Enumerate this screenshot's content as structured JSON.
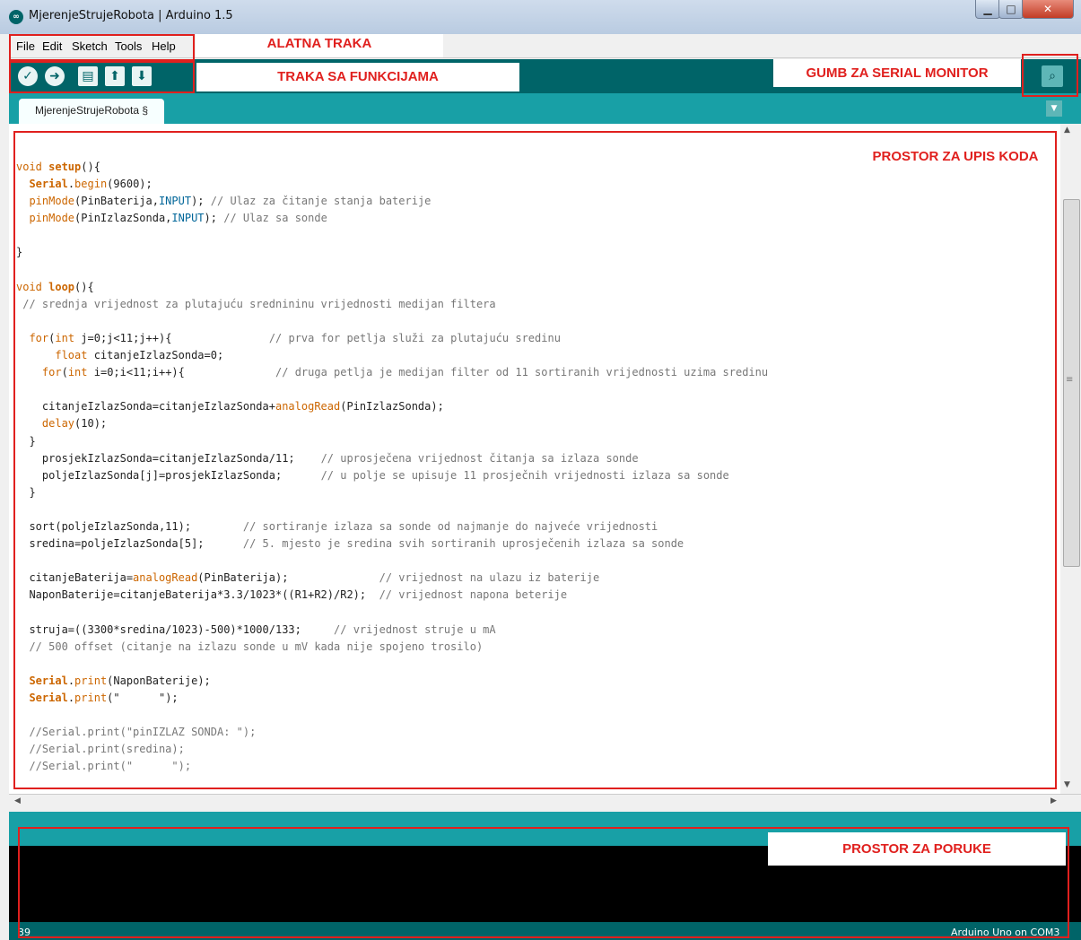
{
  "window": {
    "title": "MjerenjeStrujeRobota | Arduino 1.5",
    "app_icon": "arduino-infinity-icon",
    "controls": {
      "minimize": "minimize-icon",
      "maximize": "maximize-icon",
      "close": "close-icon"
    }
  },
  "menu": [
    "File",
    "Edit",
    "Sketch",
    "Tools",
    "Help"
  ],
  "toolbar": {
    "buttons": [
      {
        "name": "verify",
        "icon": "checkmark-icon"
      },
      {
        "name": "upload",
        "icon": "arrow-right-icon"
      },
      {
        "name": "new",
        "icon": "new-file-icon"
      },
      {
        "name": "open",
        "icon": "upload-arrow-icon"
      },
      {
        "name": "save",
        "icon": "download-arrow-icon"
      }
    ],
    "serial_monitor_icon": "magnifier-icon"
  },
  "tab": {
    "label": "MjerenjeStrujeRobota §"
  },
  "status": {
    "line": "39",
    "board": "Arduino Uno on COM3"
  },
  "annotations": {
    "menubar": "ALATNA TRAKA",
    "toolbar": "TRAKA SA FUNKCIJAMA",
    "serial": "GUMB ZA SERIAL MONITOR",
    "editor": "PROSTOR ZA UPIS KODA",
    "messages": "PROSTOR ZA PORUKE"
  },
  "colors": {
    "teal_dark": "#006468",
    "teal_light": "#18a0a6",
    "annotation_red": "#e0201e"
  },
  "code": [
    [
      {
        "t": "void ",
        "c": "kw"
      },
      {
        "t": "setup",
        "c": "bold"
      },
      {
        "t": "(){"
      }
    ],
    [
      {
        "t": "  "
      },
      {
        "t": "Serial",
        "c": "bold"
      },
      {
        "t": "."
      },
      {
        "t": "begin",
        "c": "kw"
      },
      {
        "t": "(9600);"
      }
    ],
    [
      {
        "t": "  "
      },
      {
        "t": "pinMode",
        "c": "kw"
      },
      {
        "t": "(PinBaterija,"
      },
      {
        "t": "INPUT",
        "c": "const"
      },
      {
        "t": "); "
      },
      {
        "t": "// Ulaz za čitanje stanja baterije",
        "c": "cm"
      }
    ],
    [
      {
        "t": "  "
      },
      {
        "t": "pinMode",
        "c": "kw"
      },
      {
        "t": "(PinIzlazSonda,"
      },
      {
        "t": "INPUT",
        "c": "const"
      },
      {
        "t": "); "
      },
      {
        "t": "// Ulaz sa sonde",
        "c": "cm"
      }
    ],
    [],
    [
      {
        "t": "}"
      }
    ],
    [],
    [
      {
        "t": "void ",
        "c": "kw"
      },
      {
        "t": "loop",
        "c": "bold"
      },
      {
        "t": "(){"
      }
    ],
    [
      {
        "t": " // srednja vrijednost za plutajuću srednininu vrijednosti medijan filtera",
        "c": "cm"
      }
    ],
    [],
    [
      {
        "t": "  "
      },
      {
        "t": "for",
        "c": "kw"
      },
      {
        "t": "("
      },
      {
        "t": "int",
        "c": "kw"
      },
      {
        "t": " j=0;j<11;j++){               "
      },
      {
        "t": "// prva for petlja služi za plutajuću sredinu",
        "c": "cm"
      }
    ],
    [
      {
        "t": "      "
      },
      {
        "t": "float",
        "c": "kw"
      },
      {
        "t": " citanjeIzlazSonda=0;"
      }
    ],
    [
      {
        "t": "    "
      },
      {
        "t": "for",
        "c": "kw"
      },
      {
        "t": "("
      },
      {
        "t": "int",
        "c": "kw"
      },
      {
        "t": " i=0;i<11;i++){              "
      },
      {
        "t": "// druga petlja je medijan filter od 11 sortiranih vrijednosti uzima sredinu",
        "c": "cm"
      }
    ],
    [],
    [
      {
        "t": "    citanjeIzlazSonda=citanjeIzlazSonda+"
      },
      {
        "t": "analogRead",
        "c": "kw"
      },
      {
        "t": "(PinIzlazSonda);"
      }
    ],
    [
      {
        "t": "    "
      },
      {
        "t": "delay",
        "c": "kw"
      },
      {
        "t": "(10);"
      }
    ],
    [
      {
        "t": "  }"
      }
    ],
    [
      {
        "t": "    prosjekIzlazSonda=citanjeIzlazSonda/11;    "
      },
      {
        "t": "// uprosječena vrijednost čitanja sa izlaza sonde",
        "c": "cm"
      }
    ],
    [
      {
        "t": "    poljeIzlazSonda[j]=prosjekIzlazSonda;      "
      },
      {
        "t": "// u polje se upisuje 11 prosječnih vrijednosti izlaza sa sonde",
        "c": "cm"
      }
    ],
    [
      {
        "t": "  }"
      }
    ],
    [],
    [
      {
        "t": "  sort(poljeIzlazSonda,11);        "
      },
      {
        "t": "// sortiranje izlaza sa sonde od najmanje do najveće vrijednosti",
        "c": "cm"
      }
    ],
    [
      {
        "t": "  sredina=poljeIzlazSonda[5];      "
      },
      {
        "t": "// 5. mjesto je sredina svih sortiranih uprosječenih izlaza sa sonde",
        "c": "cm"
      }
    ],
    [],
    [
      {
        "t": "  citanjeBaterija="
      },
      {
        "t": "analogRead",
        "c": "kw"
      },
      {
        "t": "(PinBaterija);              "
      },
      {
        "t": "// vrijednost na ulazu iz baterije",
        "c": "cm"
      }
    ],
    [
      {
        "t": "  NaponBaterije=citanjeBaterija*3.3/1023*((R1+R2)/R2);  "
      },
      {
        "t": "// vrijednost napona beterije",
        "c": "cm"
      }
    ],
    [],
    [
      {
        "t": "  struja=((3300*sredina/1023)-500)*1000/133;     "
      },
      {
        "t": "// vrijednost struje u mA",
        "c": "cm"
      }
    ],
    [
      {
        "t": "  // 500 offset (citanje na izlazu sonde u mV kada nije spojeno trosilo)",
        "c": "cm"
      }
    ],
    [],
    [
      {
        "t": "  "
      },
      {
        "t": "Serial",
        "c": "bold"
      },
      {
        "t": "."
      },
      {
        "t": "print",
        "c": "kw"
      },
      {
        "t": "(NaponBaterije);"
      }
    ],
    [
      {
        "t": "  "
      },
      {
        "t": "Serial",
        "c": "bold"
      },
      {
        "t": "."
      },
      {
        "t": "print",
        "c": "kw"
      },
      {
        "t": "(\"      \");"
      }
    ],
    [],
    [
      {
        "t": "  //Serial.print(\"pinIZLAZ SONDA: \");",
        "c": "cm"
      }
    ],
    [
      {
        "t": "  //Serial.print(sredina);",
        "c": "cm"
      }
    ],
    [
      {
        "t": "  //Serial.print(\"      \");",
        "c": "cm"
      }
    ]
  ]
}
